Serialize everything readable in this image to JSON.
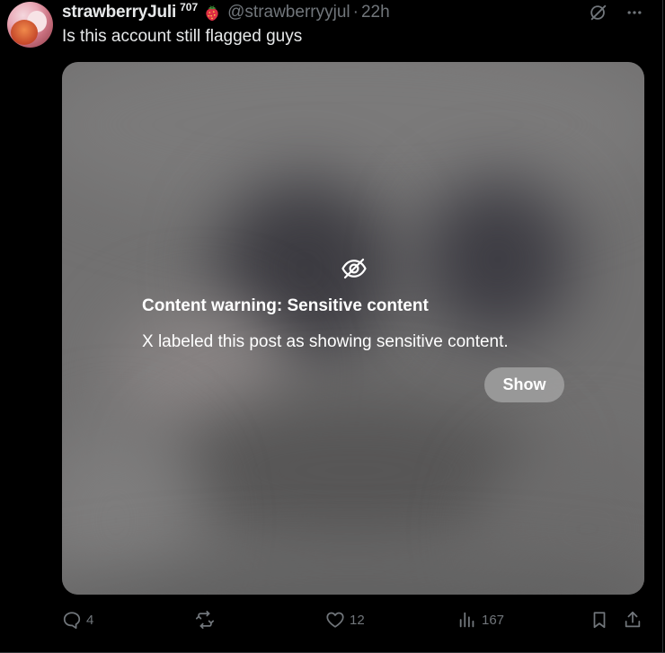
{
  "post": {
    "author": {
      "display_name": "strawberryJuli",
      "badge_number": "707",
      "handle": "@strawberryyjul",
      "separator": "·",
      "time": "22h",
      "emoji": "strawberry-emoji"
    },
    "text": "Is this account still flagged guys",
    "media": {
      "warning_icon": "eye-slash-icon",
      "warning_title": "Content warning: Sensitive content",
      "warning_body": "X labeled this post as showing sensitive content.",
      "show_label": "Show"
    },
    "top_icons": [
      "grok-icon",
      "more-icon"
    ],
    "actions": {
      "reply_count": "4",
      "retweet_count": "",
      "like_count": "12",
      "views_count": "167"
    }
  },
  "colors": {
    "background": "#000000",
    "text_primary": "#e7e9ea",
    "text_secondary": "#71767b",
    "media_gray": "#727171"
  }
}
